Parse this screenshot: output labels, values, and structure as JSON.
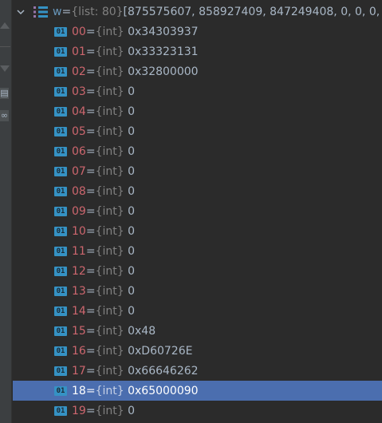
{
  "variable": {
    "name": "w",
    "equals": " = ",
    "type": "{list: 80}",
    "value": " [875575607, 858927409, 847249408, 0, 0, 0,"
  },
  "rows": [
    {
      "index": "00",
      "type": "{int}",
      "value": "0x34303937"
    },
    {
      "index": "01",
      "type": "{int}",
      "value": "0x33323131"
    },
    {
      "index": "02",
      "type": "{int}",
      "value": "0x32800000"
    },
    {
      "index": "03",
      "type": "{int}",
      "value": "0"
    },
    {
      "index": "04",
      "type": "{int}",
      "value": "0"
    },
    {
      "index": "05",
      "type": "{int}",
      "value": "0"
    },
    {
      "index": "06",
      "type": "{int}",
      "value": "0"
    },
    {
      "index": "07",
      "type": "{int}",
      "value": "0"
    },
    {
      "index": "08",
      "type": "{int}",
      "value": "0"
    },
    {
      "index": "09",
      "type": "{int}",
      "value": "0"
    },
    {
      "index": "10",
      "type": "{int}",
      "value": "0"
    },
    {
      "index": "11",
      "type": "{int}",
      "value": "0"
    },
    {
      "index": "12",
      "type": "{int}",
      "value": "0"
    },
    {
      "index": "13",
      "type": "{int}",
      "value": "0"
    },
    {
      "index": "14",
      "type": "{int}",
      "value": "0"
    },
    {
      "index": "15",
      "type": "{int}",
      "value": "0x48"
    },
    {
      "index": "16",
      "type": "{int}",
      "value": "0xD60726E"
    },
    {
      "index": "17",
      "type": "{int}",
      "value": "0x66646262"
    },
    {
      "index": "18",
      "type": "{int}",
      "value": "0x65000090",
      "selected": true
    },
    {
      "index": "19",
      "type": "{int}",
      "value": "0"
    }
  ],
  "badge_text": "01",
  "equals_text": " = ",
  "colors": {
    "background": "#2b2b2b",
    "index": "#cc666e",
    "type": "#808080",
    "value": "#a9b7c6",
    "badge": "#3592c4",
    "selection": "#4b6eaf"
  },
  "icons": {
    "expand": "chevron-down-icon",
    "list": "list-icon",
    "int": "int-type-icon"
  }
}
